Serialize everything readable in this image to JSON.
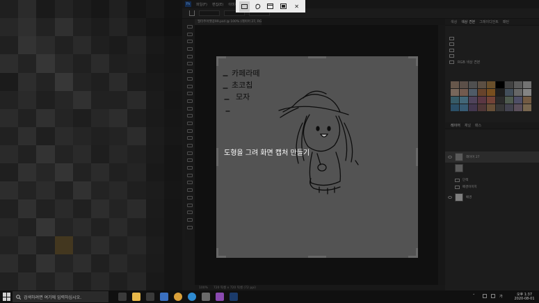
{
  "snip": {
    "modes": [
      {
        "icon": "rectangle-snip-icon",
        "active": true
      },
      {
        "icon": "freeform-snip-icon",
        "active": false
      },
      {
        "icon": "window-snip-icon",
        "active": false
      },
      {
        "icon": "fullscreen-snip-icon",
        "active": false
      }
    ],
    "close_icon": "close-icon",
    "hint": "도형을 그려 화면 캡처 만들기"
  },
  "photoshop": {
    "menu": [
      "파일(F)",
      "편집(E)",
      "이미지(I)"
    ],
    "doc_tab": "필터주어쨋꽁99.psd @ 100% (레이어 27, RGB/8#)",
    "drawing_text": [
      "카페라떼",
      "초코칩",
      "모자"
    ],
    "panel_tabs": [
      "색상",
      "색상 견본",
      "그레이디언트",
      "패턴"
    ],
    "swatch_folder_label": "RGB 색상 견본",
    "swatch_colors": [
      "#8a7565",
      "#7a6a60",
      "#6a6a6a",
      "#7b6a5a",
      "#8c6a3a",
      "#000000",
      "#5a5a5a",
      "#7a7a7a",
      "#9a9a9a",
      "#a08a7a",
      "#9a7a6a",
      "#6a7a8a",
      "#8a5a3a",
      "#a06a2a",
      "#2a2a2a",
      "#5a6a7a",
      "#8a8a8a",
      "#b0b0b0",
      "#4a7a8a",
      "#5a8aa0",
      "#6a5a7a",
      "#7a4a5a",
      "#9a5a4a",
      "#3a3a3a",
      "#6a7a6a",
      "#6a6a8a",
      "#9a7a5a",
      "#3a6a8a",
      "#4a7a9a",
      "#5a4a6a",
      "#6a4a4a",
      "#8a6a4a",
      "#4a4a4a",
      "#5a5a6a",
      "#7a6a7a",
      "#a08a6a"
    ],
    "layers_tabs": [
      "레이어",
      "채널",
      "패스"
    ],
    "layers": [
      {
        "name": "레이어 27",
        "visible": true
      },
      {
        "name": "",
        "visible": false
      },
      {
        "name": "단색",
        "visible": false
      },
      {
        "name": "배경이미지",
        "visible": false
      },
      {
        "name": "배경",
        "visible": true
      }
    ],
    "status": [
      "100%",
      "720 픽셀 x 720 픽셀 (72 ppi)"
    ]
  },
  "taskbar": {
    "search_placeholder": "검색하려면 여기에 입력하십시오.",
    "time": "오후 1:37",
    "date": "2020-08-01",
    "apps": [
      {
        "icon": "task-view-icon",
        "color": "#3a3a3a"
      },
      {
        "icon": "file-explorer-icon",
        "color": "#e8b84a"
      },
      {
        "icon": "store-icon",
        "color": "#3a3a3a"
      },
      {
        "icon": "mail-icon",
        "color": "#3a6fbf"
      },
      {
        "icon": "chrome-icon",
        "color": "#d9a03a"
      },
      {
        "icon": "edge-icon",
        "color": "#2e8ad1"
      },
      {
        "icon": "settings-icon",
        "color": "#6a6a6a"
      },
      {
        "icon": "onenote-icon",
        "color": "#8a4ab0"
      },
      {
        "icon": "photoshop-icon",
        "color": "#1b3b6b"
      }
    ]
  },
  "mosaic_colors": [
    "#2a2a2a",
    "#3a3a3a",
    "#232323",
    "#2f2f2f",
    "#262626",
    "#1f1f1f",
    "#2b2b2b",
    "#1d1d1d",
    "#222",
    "#1a1a1a",
    "#343434",
    "#3f3f3f",
    "#2e2e2e",
    "#404040",
    "#2c2c2c",
    "#262626",
    "#303030",
    "#232323",
    "#1d1d1d",
    "#191919",
    "#2b2b2b",
    "#444",
    "#3a3a3a",
    "#2d2d2d",
    "#383838",
    "#2a2a2a",
    "#252525",
    "#2f2f2f",
    "#222",
    "#1c1c1c",
    "#3c3c3c",
    "#2f2f2f",
    "#484848",
    "#363636",
    "#2b2b2b",
    "#3a3a3a",
    "#2a2a2a",
    "#2c2c2c",
    "#1f1f1f",
    "#1c1c1c",
    "#252525",
    "#3d3d3d",
    "#2f2f2f",
    "#4a4a4a",
    "#303030",
    "#2a2a2a",
    "#3a3a3a",
    "#262626",
    "#222",
    "#1e1e1e",
    "#2e2e2e",
    "#383838",
    "#2a2a2a",
    "#333",
    "#424242",
    "#2c2c2c",
    "#2d2d2d",
    "#383838",
    "#242424",
    "#1c1c1c",
    "#3a3a3a",
    "#2c2c2c",
    "#404040",
    "#303030",
    "#292929",
    "#353535",
    "#3c3c3c",
    "#2a2a2a",
    "#232323",
    "#1e1e1e",
    "#2c2c2c",
    "#3e3e3e",
    "#2a2a2a",
    "#3a3a3a",
    "#323232",
    "#2b2b2b",
    "#2f2f2f",
    "#3b3b3b",
    "#262626",
    "#1f1f1f",
    "#383838",
    "#2d2d2d",
    "#454545",
    "#2f2f2f",
    "#393939",
    "#282828",
    "#343434",
    "#2c2c2c",
    "#242424",
    "#1d1d1d",
    "#2a2a2a",
    "#404040",
    "#333",
    "#464646",
    "#2e2e2e",
    "#3a3a3a",
    "#2b2b2b",
    "#303030",
    "#222",
    "#1c1c1c",
    "#3d3d3d",
    "#2f2f2f",
    "#3b3b3b",
    "#2c2c2c",
    "#424242",
    "#2f2f2f",
    "#363636",
    "#2a2a2a",
    "#262626",
    "#1e1e1e",
    "#2b2b2b",
    "#414141",
    "#2d2d2d",
    "#383838",
    "#2b2b2b",
    "#3c3c3c",
    "#2f2f2f",
    "#3a3a3a",
    "#242424",
    "#1d1d1d",
    "#363636",
    "#2c2c2c",
    "#474747",
    "#303030",
    "#3a3a3a",
    "#2d2d2d",
    "#383838",
    "#2b2b2b",
    "#232323",
    "#1c1c1c",
    "#2e2e2e",
    "#3d3d3d",
    "#2c2c2c",
    "#5a4a2a",
    "#2f2f2f",
    "#3b3b3b",
    "#2c2c2c",
    "#353535",
    "#262626",
    "#1d1d1d",
    "#3b3b3b",
    "#2b2b2b",
    "#434343",
    "#303030",
    "#3d3d3d",
    "#2b2b2b",
    "#373737",
    "#2d2d2d",
    "#242424",
    "#1c1c1c",
    "#2c2c2c",
    "#3a3a3a",
    "#2e2e2e",
    "#3b3b3b",
    "#2b2b2b",
    "#363636",
    "#2a2a2a",
    "#333",
    "#222",
    "#1c1c1c"
  ]
}
